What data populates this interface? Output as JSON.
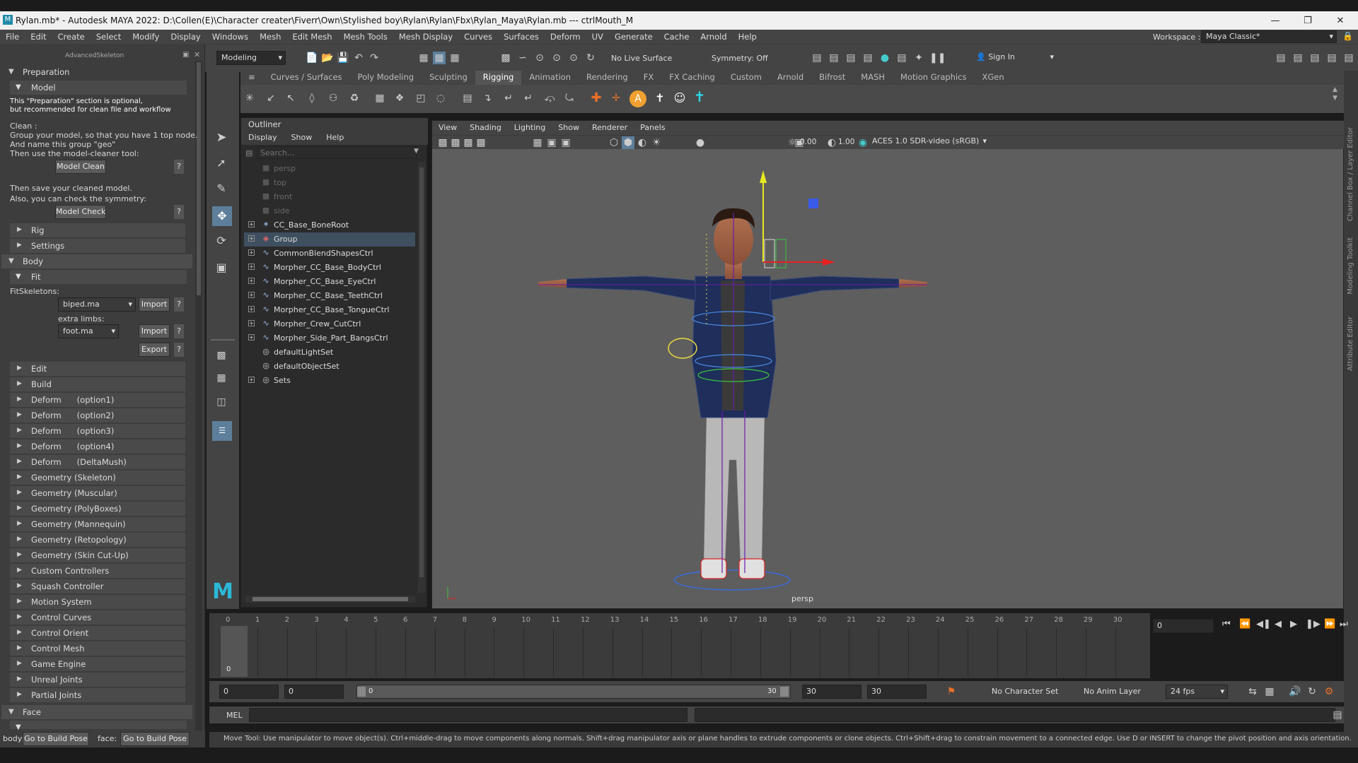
{
  "window": {
    "title": "Rylan.mb* - Autodesk MAYA 2022: D:\\Collen(E)\\Character creater\\Fiverr\\Own\\Stylished boy\\Rylan\\Rylan\\Fbx\\Rylan_Maya\\Rylan.mb  ---  ctrlMouth_M"
  },
  "menubar": [
    "File",
    "Edit",
    "Create",
    "Select",
    "Modify",
    "Display",
    "Windows",
    "Mesh",
    "Edit Mesh",
    "Mesh Tools",
    "Mesh Display",
    "Curves",
    "Surfaces",
    "Deform",
    "UV",
    "Generate",
    "Cache",
    "Arnold",
    "Help"
  ],
  "workspace": {
    "label": "Workspace :",
    "value": "Maya Classic*"
  },
  "toolbar": {
    "mode": "Modeling",
    "live_surface": "No Live Surface",
    "symmetry": "Symmetry: Off",
    "sign_in": "Sign In"
  },
  "left_panel": {
    "title": "AdvancedSkeleton",
    "preparation": "Preparation",
    "model": "Model",
    "note1": "This \"Preparation\" section is optional,",
    "note2": "but recommended for clean file and workflow",
    "clean": "Clean :",
    "clean_l1": "Group your model, so that you have 1 top node.",
    "clean_l2": "And name this group \"geo\"",
    "clean_l3": "Then use the model-cleaner tool:",
    "model_clean": "Model Clean",
    "save_l1": "Then save your cleaned model.",
    "save_l2": "Also, you can check the symmetry:",
    "model_check": "Model Check",
    "help": "?",
    "rig": "Rig",
    "settings": "Settings",
    "body": "Body",
    "fit": "Fit",
    "fit_skeletons": "FitSkeletons:",
    "biped": "biped.ma",
    "import": "Import",
    "extra_limbs": "extra limbs:",
    "foot": "foot.ma",
    "export": "Export",
    "items": [
      "Edit",
      "Build",
      "Deform      (option1)",
      "Deform      (option2)",
      "Deform      (option3)",
      "Deform      (option4)",
      "Deform      (DeltaMush)",
      "Geometry (Skeleton)",
      "Geometry (Muscular)",
      "Geometry (PolyBoxes)",
      "Geometry (Mannequin)",
      "Geometry (Retopology)",
      "Geometry (Skin Cut-Up)",
      "Custom Controllers",
      "Squash Controller",
      "Motion System",
      "Control Curves",
      "Control Orient",
      "Control Mesh",
      "Game Engine",
      "Unreal Joints",
      "Partial Joints"
    ],
    "face": "Face",
    "body_label": "body:",
    "face_label": "face:",
    "go_build_pose": "Go to Build Pose"
  },
  "shelf_tabs": [
    "Curves / Surfaces",
    "Poly Modeling",
    "Sculpting",
    "Rigging",
    "Animation",
    "Rendering",
    "FX",
    "FX Caching",
    "Custom",
    "Arnold",
    "Bifrost",
    "MASH",
    "Motion Graphics",
    "XGen"
  ],
  "shelf_active": "Rigging",
  "outliner": {
    "title": "Outliner",
    "menu": [
      "Display",
      "Show",
      "Help"
    ],
    "search_placeholder": "Search...",
    "rows": [
      {
        "label": "persp",
        "icon": "camera-icon",
        "dim": true,
        "exp": false
      },
      {
        "label": "top",
        "icon": "camera-icon",
        "dim": true,
        "exp": false
      },
      {
        "label": "front",
        "icon": "camera-icon",
        "dim": true,
        "exp": false
      },
      {
        "label": "side",
        "icon": "camera-icon",
        "dim": true,
        "exp": false
      },
      {
        "label": "CC_Base_BoneRoot",
        "icon": "joint-icon",
        "dim": false,
        "exp": true
      },
      {
        "label": "Group",
        "icon": "group-icon",
        "dim": false,
        "exp": true,
        "sel": true
      },
      {
        "label": "CommonBlendShapesCtrl",
        "icon": "curve-icon",
        "dim": false,
        "exp": true
      },
      {
        "label": "Morpher_CC_Base_BodyCtrl",
        "icon": "curve-icon",
        "dim": false,
        "exp": true
      },
      {
        "label": "Morpher_CC_Base_EyeCtrl",
        "icon": "curve-icon",
        "dim": false,
        "exp": true
      },
      {
        "label": "Morpher_CC_Base_TeethCtrl",
        "icon": "curve-icon",
        "dim": false,
        "exp": true
      },
      {
        "label": "Morpher_CC_Base_TongueCtrl",
        "icon": "curve-icon",
        "dim": false,
        "exp": true
      },
      {
        "label": "Morpher_Crew_CutCtrl",
        "icon": "curve-icon",
        "dim": false,
        "exp": true
      },
      {
        "label": "Morpher_Side_Part_BangsCtrl",
        "icon": "curve-icon",
        "dim": false,
        "exp": true
      },
      {
        "label": "defaultLightSet",
        "icon": "set-icon",
        "dim": false,
        "exp": false
      },
      {
        "label": "defaultObjectSet",
        "icon": "set-icon",
        "dim": false,
        "exp": false
      },
      {
        "label": "Sets",
        "icon": "set-icon",
        "dim": false,
        "exp": true
      }
    ]
  },
  "viewport": {
    "menu": [
      "View",
      "Shading",
      "Lighting",
      "Show",
      "Renderer",
      "Panels"
    ],
    "near": "0.00",
    "far": "1.00",
    "colorspace": "ACES 1.0 SDR-video (sRGB)",
    "camera": "persp"
  },
  "timeline": {
    "start": 0,
    "end": 30,
    "current_label": "0",
    "current_frame_field": "0"
  },
  "range": {
    "start1": "0",
    "start2": "0",
    "slider_start": "0",
    "slider_end": "30",
    "end1": "30",
    "end2": "30",
    "character_set": "No Character Set",
    "anim_layer": "No Anim Layer",
    "fps": "24 fps"
  },
  "cmd": {
    "label": "MEL"
  },
  "status": "Move Tool: Use manipulator to move object(s). Ctrl+middle-drag to move components along normals. Shift+drag manipulator axis or plane handles to extrude components or clone objects. Ctrl+Shift+drag to constrain movement to a connected edge. Use D or INSERT to change the pivot position and axis orientation.",
  "right_strip": [
    "Channel Box / Layer Editor",
    "Modeling Toolkit",
    "Attribute Editor"
  ]
}
